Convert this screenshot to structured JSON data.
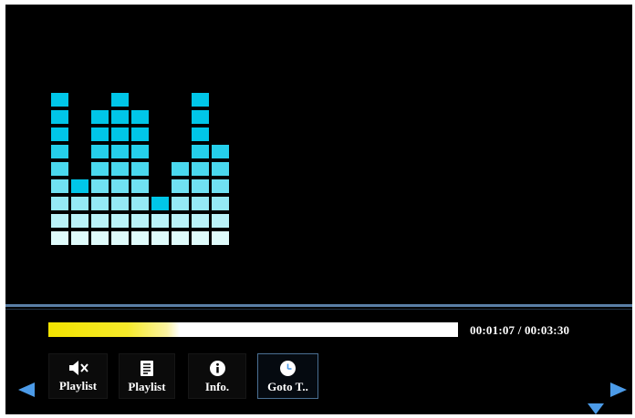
{
  "player": {
    "elapsed": "00:01:07",
    "total": "00:03:30",
    "time_display": "00:01:07 / 00:03:30",
    "progress": 0.32
  },
  "controls": [
    {
      "label": "Playlist",
      "icon": "mute-icon"
    },
    {
      "label": "Playlist",
      "icon": "playlist-icon"
    },
    {
      "label": "Info.",
      "icon": "info-icon"
    },
    {
      "label": "Goto T..",
      "icon": "clock-icon",
      "selected": true
    }
  ],
  "nav": {
    "left": "left-arrow-icon",
    "right": "right-arrow-icon",
    "down": "down-arrow-icon"
  },
  "equalizer": {
    "levels": [
      9,
      4,
      8,
      9,
      8,
      3,
      5,
      9,
      6
    ],
    "colors": {
      "low": "#dffbfb",
      "high": "#00c6e8"
    }
  },
  "colors": {
    "screen_bg": "#000000",
    "accent": "#4c9be8",
    "progress": "#f2e300",
    "divider": "#5a7fa6"
  }
}
